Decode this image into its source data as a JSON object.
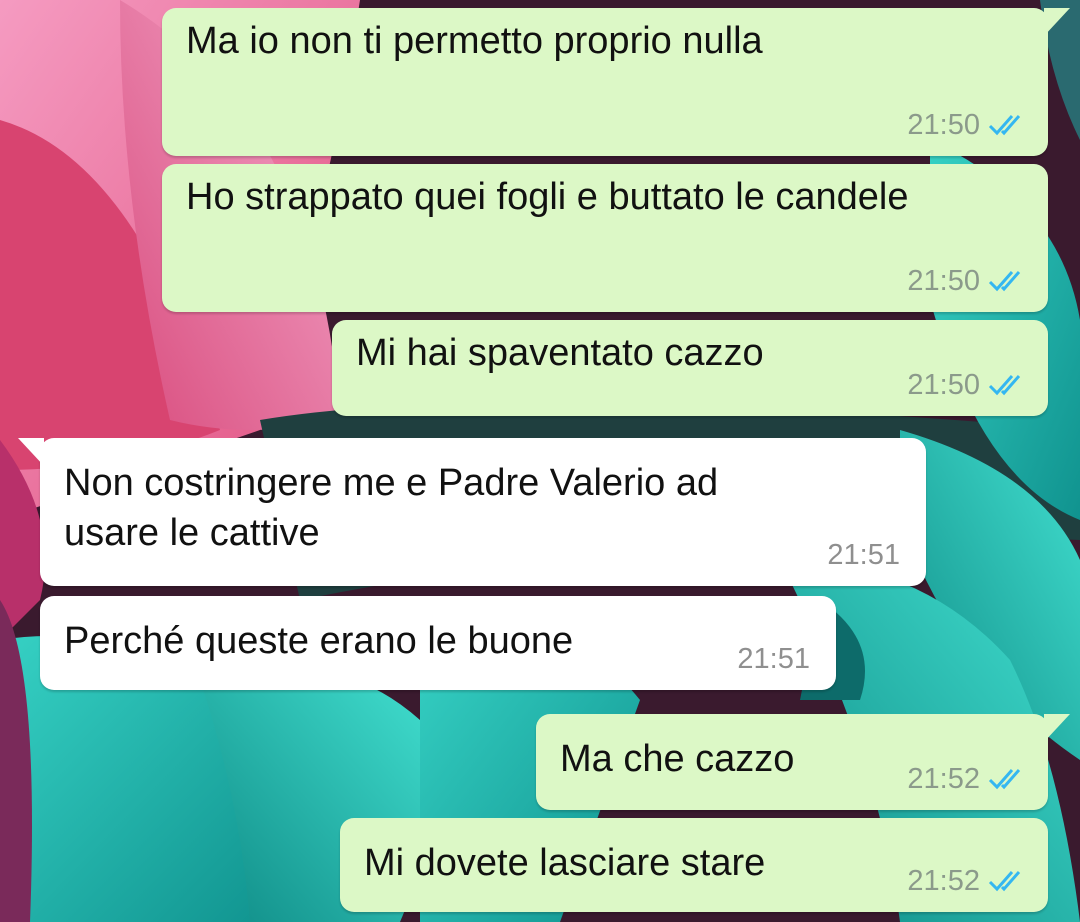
{
  "colors": {
    "outgoing_bubble": "#dcf8c6",
    "incoming_bubble": "#ffffff",
    "read_ticks": "#34b7f1",
    "timestamp": "#8b9a8b"
  },
  "icons": {
    "read_receipt": "double-check-icon"
  },
  "messages": [
    {
      "direction": "outgoing",
      "text": "Ma io non ti permetto proprio nulla",
      "time": "21:50",
      "status": "read"
    },
    {
      "direction": "outgoing",
      "text": "Ho strappato quei fogli e buttato le candele",
      "time": "21:50",
      "status": "read"
    },
    {
      "direction": "outgoing",
      "text": "Mi hai spaventato cazzo",
      "time": "21:50",
      "status": "read"
    },
    {
      "direction": "incoming",
      "text": "Non costringere me e Padre Valerio ad\nusare le cattive",
      "time": "21:51"
    },
    {
      "direction": "incoming",
      "text": "Perché queste erano le buone",
      "time": "21:51"
    },
    {
      "direction": "outgoing",
      "text": "Ma che cazzo",
      "time": "21:52",
      "status": "read"
    },
    {
      "direction": "outgoing",
      "text": "Mi dovete lasciare stare",
      "time": "21:52",
      "status": "read"
    }
  ]
}
